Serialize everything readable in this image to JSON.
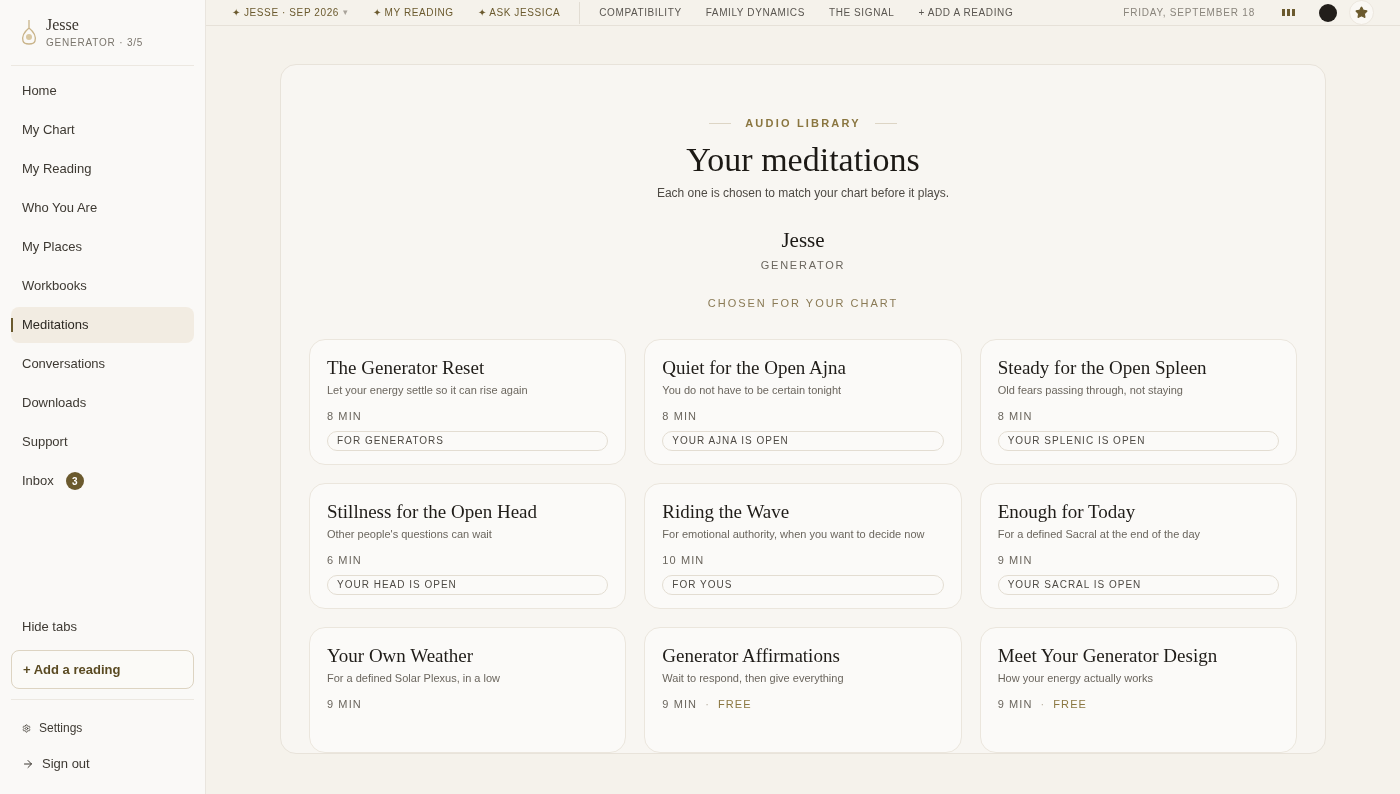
{
  "profile": {
    "name": "Jesse",
    "meta": "GENERATOR · 3/5"
  },
  "topnav": [
    {
      "kind": "accent",
      "label": "✦ JESSE · SEP 2026",
      "caret": "▾"
    },
    {
      "kind": "accent",
      "label": "✦ MY READING"
    },
    {
      "kind": "accent",
      "label": "✦ ASK JESSICA"
    },
    {
      "kind": "plain",
      "label": "COMPATIBILITY"
    },
    {
      "kind": "plain",
      "label": "FAMILY DYNAMICS"
    },
    {
      "kind": "plain",
      "label": "THE SIGNAL"
    },
    {
      "kind": "plain",
      "label": "+ ADD A READING"
    }
  ],
  "date": "FRIDAY, SEPTEMBER 18",
  "sidebar": {
    "items": [
      {
        "label": "Home",
        "selected": false
      },
      {
        "label": "My Chart",
        "selected": false
      },
      {
        "label": "My Reading",
        "selected": false
      },
      {
        "label": "Who You Are",
        "selected": false
      },
      {
        "label": "My Places",
        "selected": false
      },
      {
        "label": "Workbooks",
        "selected": false
      },
      {
        "label": "Meditations",
        "selected": true
      },
      {
        "label": "Conversations",
        "selected": false
      },
      {
        "label": "Downloads",
        "selected": false
      },
      {
        "label": "Support",
        "selected": false
      },
      {
        "label": "Inbox",
        "selected": false,
        "badge": "3"
      }
    ],
    "hide_tabs": "Hide tabs",
    "add_reading": "+ Add a reading",
    "settings": "Settings",
    "sign_out": "Sign out"
  },
  "library": {
    "eyebrow": "AUDIO LIBRARY",
    "title": "Your meditations",
    "subtitle": "Each one is chosen to match your chart before it plays.",
    "person": "Jesse",
    "type": "GENERATOR",
    "section": "CHOSEN FOR YOUR CHART",
    "cards": [
      {
        "title": "The Generator Reset",
        "subtitle": "Let your energy settle so it can rise again",
        "duration": "8 MIN",
        "tag": "FOR GENERATORS"
      },
      {
        "title": "Quiet for the Open Ajna",
        "subtitle": "You do not have to be certain tonight",
        "duration": "8 MIN",
        "tag": "YOUR AJNA IS OPEN"
      },
      {
        "title": "Steady for the Open Spleen",
        "subtitle": "Old fears passing through, not staying",
        "duration": "8 MIN",
        "tag": "YOUR SPLENIC IS OPEN"
      },
      {
        "title": "Stillness for the Open Head",
        "subtitle": "Other people's questions can wait",
        "duration": "6 MIN",
        "tag": "YOUR HEAD IS OPEN"
      },
      {
        "title": "Riding the Wave",
        "subtitle": "For emotional authority, when you want to decide now",
        "duration": "10 MIN",
        "tag": "FOR YOUS"
      },
      {
        "title": "Enough for Today",
        "subtitle": "For a defined Sacral at the end of the day",
        "duration": "9 MIN",
        "tag": "YOUR SACRAL IS OPEN"
      },
      {
        "title": "Your Own Weather",
        "subtitle": "For a defined Solar Plexus, in a low",
        "duration": "9 MIN"
      },
      {
        "title": "Generator Affirmations",
        "subtitle": "Wait to respond, then give everything",
        "duration": "9 MIN",
        "separator": "·",
        "price": "FREE"
      },
      {
        "title": "Meet Your Generator Design",
        "subtitle": "How your energy actually works",
        "duration": "9 MIN",
        "separator": "·",
        "price": "FREE"
      }
    ]
  }
}
